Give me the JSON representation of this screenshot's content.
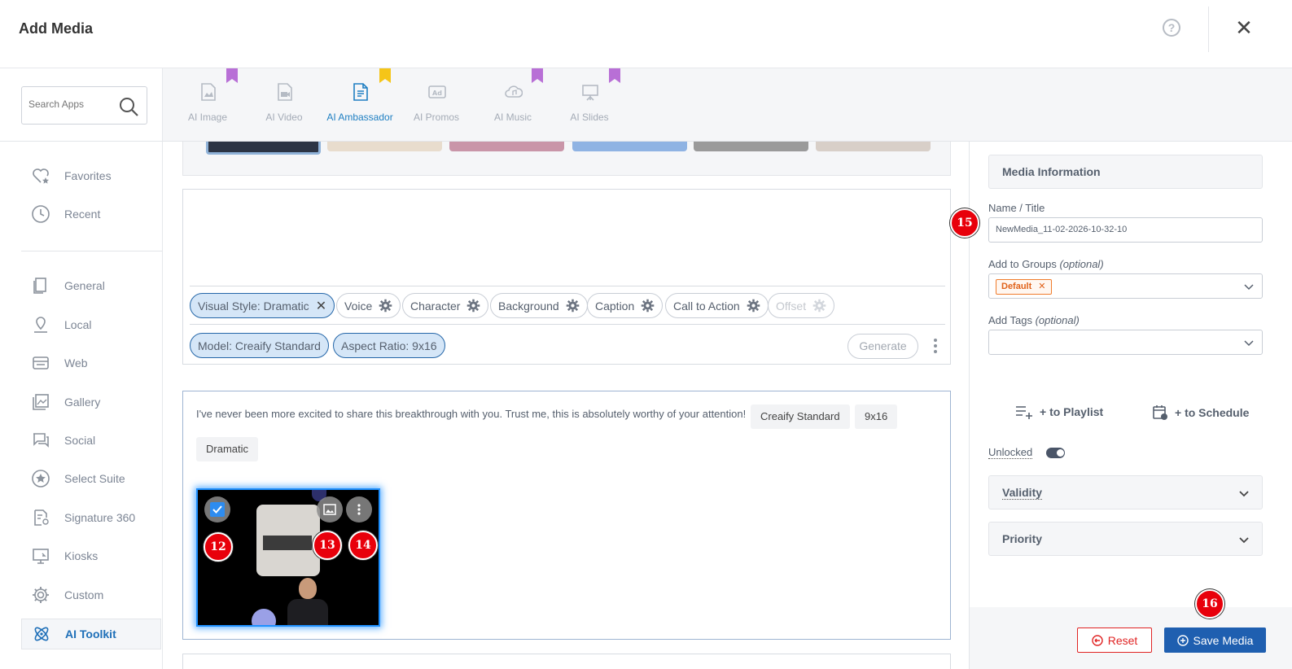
{
  "header": {
    "title": "Add Media",
    "help_icon": "help-circle-icon",
    "close_icon": "close-icon"
  },
  "sidebar": {
    "search_placeholder": "Search Apps",
    "items": [
      {
        "label": "Favorites",
        "icon": "heart-star-icon"
      },
      {
        "label": "Recent",
        "icon": "clock-icon"
      },
      {
        "label": "General",
        "icon": "document-icon"
      },
      {
        "label": "Local",
        "icon": "location-pin-icon"
      },
      {
        "label": "Web",
        "icon": "web-icon"
      },
      {
        "label": "Gallery",
        "icon": "gallery-icon"
      },
      {
        "label": "Social",
        "icon": "chat-icon"
      },
      {
        "label": "Select Suite",
        "icon": "star-circle-icon"
      },
      {
        "label": "Signature 360",
        "icon": "signature-icon"
      },
      {
        "label": "Kiosks",
        "icon": "kiosk-icon"
      },
      {
        "label": "Custom",
        "icon": "gear-icon"
      },
      {
        "label": "AI Toolkit",
        "icon": "atom-icon"
      }
    ]
  },
  "tabs": [
    {
      "label": "AI Image",
      "icon": "image-file-icon"
    },
    {
      "label": "AI Video",
      "icon": "video-file-icon"
    },
    {
      "label": "AI Ambassador",
      "icon": "ambassador-file-icon"
    },
    {
      "label": "AI Promos",
      "icon": "ad-icon"
    },
    {
      "label": "AI Music",
      "icon": "cloud-music-icon"
    },
    {
      "label": "AI Slides",
      "icon": "presentation-icon"
    }
  ],
  "prompt": {
    "chips_row1": [
      {
        "label": "Visual Style:  Dramatic"
      },
      {
        "label": "Voice"
      },
      {
        "label": "Character"
      },
      {
        "label": "Background"
      },
      {
        "label": "Caption"
      },
      {
        "label": "Call to Action"
      },
      {
        "label": "Offset"
      }
    ],
    "chips_row2": [
      {
        "label": "Model:  Creaify Standard"
      },
      {
        "label": "Aspect Ratio:  9x16"
      }
    ],
    "generate_label": "Generate"
  },
  "result": {
    "text": "I've never been more excited to share this breakthrough with you. Trust me, this is absolutely worthy of your attention!",
    "tags": [
      "Creaify Standard",
      "9x16",
      "Dramatic"
    ],
    "badges": [
      "12",
      "13",
      "14"
    ]
  },
  "right_panel": {
    "section_title": "Media Information",
    "name_label": "Name / Title",
    "name_value": "NewMedia_11-02-2026-10-32-10",
    "groups_label": "Add to Groups",
    "groups_optional": "(optional)",
    "group_tag": "Default",
    "tags_label": "Add Tags",
    "tags_optional": "(optional)",
    "to_playlist": "+ to Playlist",
    "to_schedule": "+ to Schedule",
    "unlocked_label": "Unlocked",
    "validity_label": "Validity",
    "priority_label": "Priority",
    "reset_label": "Reset",
    "save_label": "Save Media",
    "badge_15": "15",
    "badge_16": "16"
  },
  "colors": {
    "accent": "#1f5fb0",
    "badge": "#e8000b",
    "bookmark_purple": "#b86fd6",
    "bookmark_yellow": "#f5c518"
  }
}
